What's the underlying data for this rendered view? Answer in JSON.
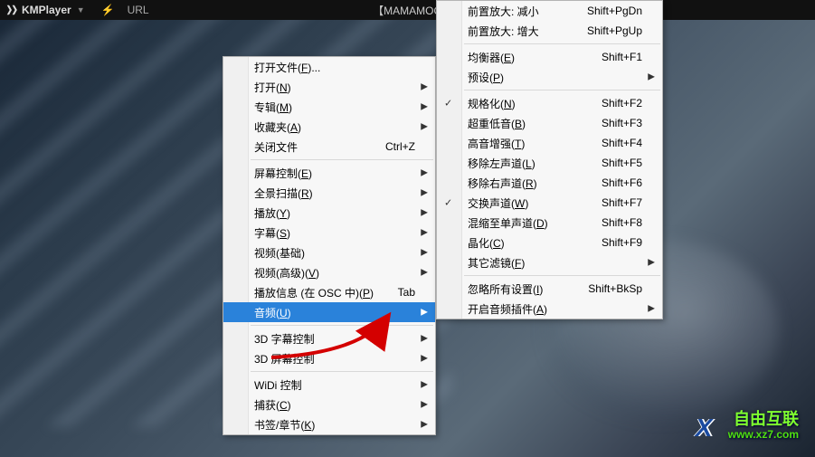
{
  "titlebar": {
    "app": "KMPlayer",
    "url_label": "URL",
    "video_title": "【MAMAMOO"
  },
  "menu1": {
    "items": [
      {
        "label": "打开文件",
        "key": "F",
        "suffix": "..."
      },
      {
        "label": "打开",
        "key": "N",
        "submenu": true
      },
      {
        "label": "专辑",
        "key": "M",
        "submenu": true
      },
      {
        "label": "收藏夹",
        "key": "A",
        "submenu": true
      },
      {
        "label": "关闭文件",
        "shortcut": "Ctrl+Z"
      }
    ],
    "items2": [
      {
        "label": "屏幕控制",
        "key": "E",
        "submenu": true
      },
      {
        "label": "全景扫描",
        "key": "R",
        "submenu": true
      },
      {
        "label": "播放",
        "key": "Y",
        "submenu": true
      },
      {
        "label": "字幕",
        "key": "S",
        "submenu": true
      },
      {
        "label": "视频(基础)",
        "submenu": true
      },
      {
        "label": "视频(高级)",
        "key": "V",
        "submenu": true
      },
      {
        "label": "播放信息 (在 OSC 中)",
        "key": "P",
        "shortcut": "Tab"
      },
      {
        "label": "音频",
        "key": "U",
        "submenu": true,
        "highlight": true
      }
    ],
    "items3": [
      {
        "label": "3D 字幕控制",
        "submenu": true
      },
      {
        "label": "3D 屏幕控制",
        "submenu": true
      }
    ],
    "items4": [
      {
        "label": "WiDi 控制",
        "submenu": true
      },
      {
        "label": "捕获",
        "key": "C",
        "submenu": true
      },
      {
        "label": "书签/章节",
        "key": "K",
        "submenu": true
      }
    ]
  },
  "menu2": {
    "items": [
      {
        "label": "前置放大: 减小",
        "shortcut": "Shift+PgDn"
      },
      {
        "label": "前置放大: 增大",
        "shortcut": "Shift+PgUp"
      }
    ],
    "items2": [
      {
        "label": "均衡器",
        "key": "E",
        "shortcut": "Shift+F1"
      },
      {
        "label": "预设",
        "key": "P",
        "submenu": true
      }
    ],
    "items3": [
      {
        "label": "规格化",
        "key": "N",
        "shortcut": "Shift+F2",
        "checked": true
      },
      {
        "label": "超重低音",
        "key": "B",
        "shortcut": "Shift+F3"
      },
      {
        "label": "高音增强",
        "key": "T",
        "shortcut": "Shift+F4"
      },
      {
        "label": "移除左声道",
        "key": "L",
        "shortcut": "Shift+F5"
      },
      {
        "label": "移除右声道",
        "key": "R",
        "shortcut": "Shift+F6"
      },
      {
        "label": "交换声道",
        "key": "W",
        "shortcut": "Shift+F7",
        "checked": true
      },
      {
        "label": "混缩至单声道",
        "key": "D",
        "shortcut": "Shift+F8"
      },
      {
        "label": "晶化",
        "key": "C",
        "shortcut": "Shift+F9"
      },
      {
        "label": "其它滤镜",
        "key": "F",
        "submenu": true
      }
    ],
    "items4": [
      {
        "label": "忽略所有设置",
        "key": "I",
        "shortcut": "Shift+BkSp"
      },
      {
        "label": "开启音频插件",
        "key": "A",
        "submenu": true
      }
    ]
  },
  "watermark": {
    "line1": "自由互联",
    "line2": "www.xz7.com"
  }
}
